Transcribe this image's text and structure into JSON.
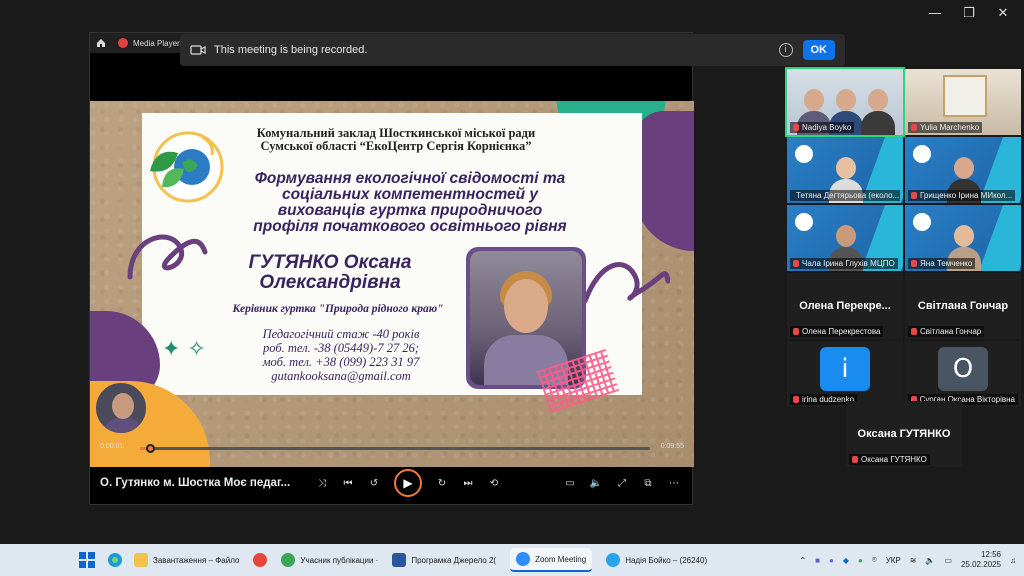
{
  "window": {
    "minimize": "—",
    "restore": "❐",
    "close": "✕"
  },
  "recording_banner": {
    "message": "This meeting is being recorded.",
    "info": "i",
    "ok_label": "OK"
  },
  "player": {
    "app_name": "Media Player",
    "current_time": "0:00:01",
    "duration": "0:09:55",
    "progress": 0.02,
    "video_title": "О. Гутянко м. Шостка Моє педаг..."
  },
  "slide": {
    "institution_line1": "Комунальний заклад Шосткинської міської ради",
    "institution_line2": "Сумської області “ЕкоЦентр Сергія Корнієнка”",
    "title_line1": "Формування екологічної свідомості та",
    "title_line2": "соціальних компетентностей у",
    "title_line3": "вихованців гуртка природничого",
    "title_line4": "профіля початкового освітнього рівня",
    "name_line1": "ГУТЯНКО Оксана",
    "name_line2": "Олександрівна",
    "role": "Керівник гуртка \"Природа рідного краю\"",
    "contact_line1": "Педагогічний стаж -40 років",
    "contact_line2": "роб. тел. -38 (05449)-7 27 26;",
    "contact_line3": "моб. тел. +38 (099) 223 31 97",
    "contact_line4": "gutankooksana@gmail.com",
    "sparkles": "✦ ✧"
  },
  "participants": [
    {
      "name": "Nadiya Boyko",
      "type": "video"
    },
    {
      "name": "Yulia Marchenko",
      "type": "video"
    },
    {
      "name": "Тетяна Дегтярьова (еколо...",
      "type": "video"
    },
    {
      "name": "Грищенко Ірина МИкол...",
      "type": "video"
    },
    {
      "name": "Чала Ірина Глухів МЦПО",
      "type": "video"
    },
    {
      "name": "Яна Темченко",
      "type": "video"
    },
    {
      "name": "Олена Перекрестова",
      "display": "Олена  Перекре...",
      "type": "name"
    },
    {
      "name": "Світлана Гончар",
      "display": "Світлана Гончар",
      "type": "name"
    },
    {
      "name": "irina dudzenko",
      "initial": "i",
      "color": "#1a8cf0",
      "type": "avatar"
    },
    {
      "name": "Сурган Оксана Вікторівна",
      "initial": "O",
      "color": "#4a5564",
      "type": "avatar"
    },
    {
      "name": "Оксана ГУТЯНКО",
      "display": "Оксана ГУТЯНКО",
      "type": "name"
    }
  ],
  "taskbar": {
    "apps": [
      {
        "label": "Завантаження – Файло",
        "color": "#f2c14e"
      },
      {
        "label": "",
        "color": "#e7463a"
      },
      {
        "label": "Учасник публікации ·",
        "color": "#3aa757"
      },
      {
        "label": "Програмка Джерело 2(",
        "color": "#2b579a"
      },
      {
        "label": "Zoom Meeting",
        "color": "#2d8cff"
      },
      {
        "label": "Надія Бойко – (26240)",
        "color": "#2aa3ef"
      }
    ],
    "lang": "УКР",
    "time": "12:56",
    "date": "25.02.2025"
  }
}
